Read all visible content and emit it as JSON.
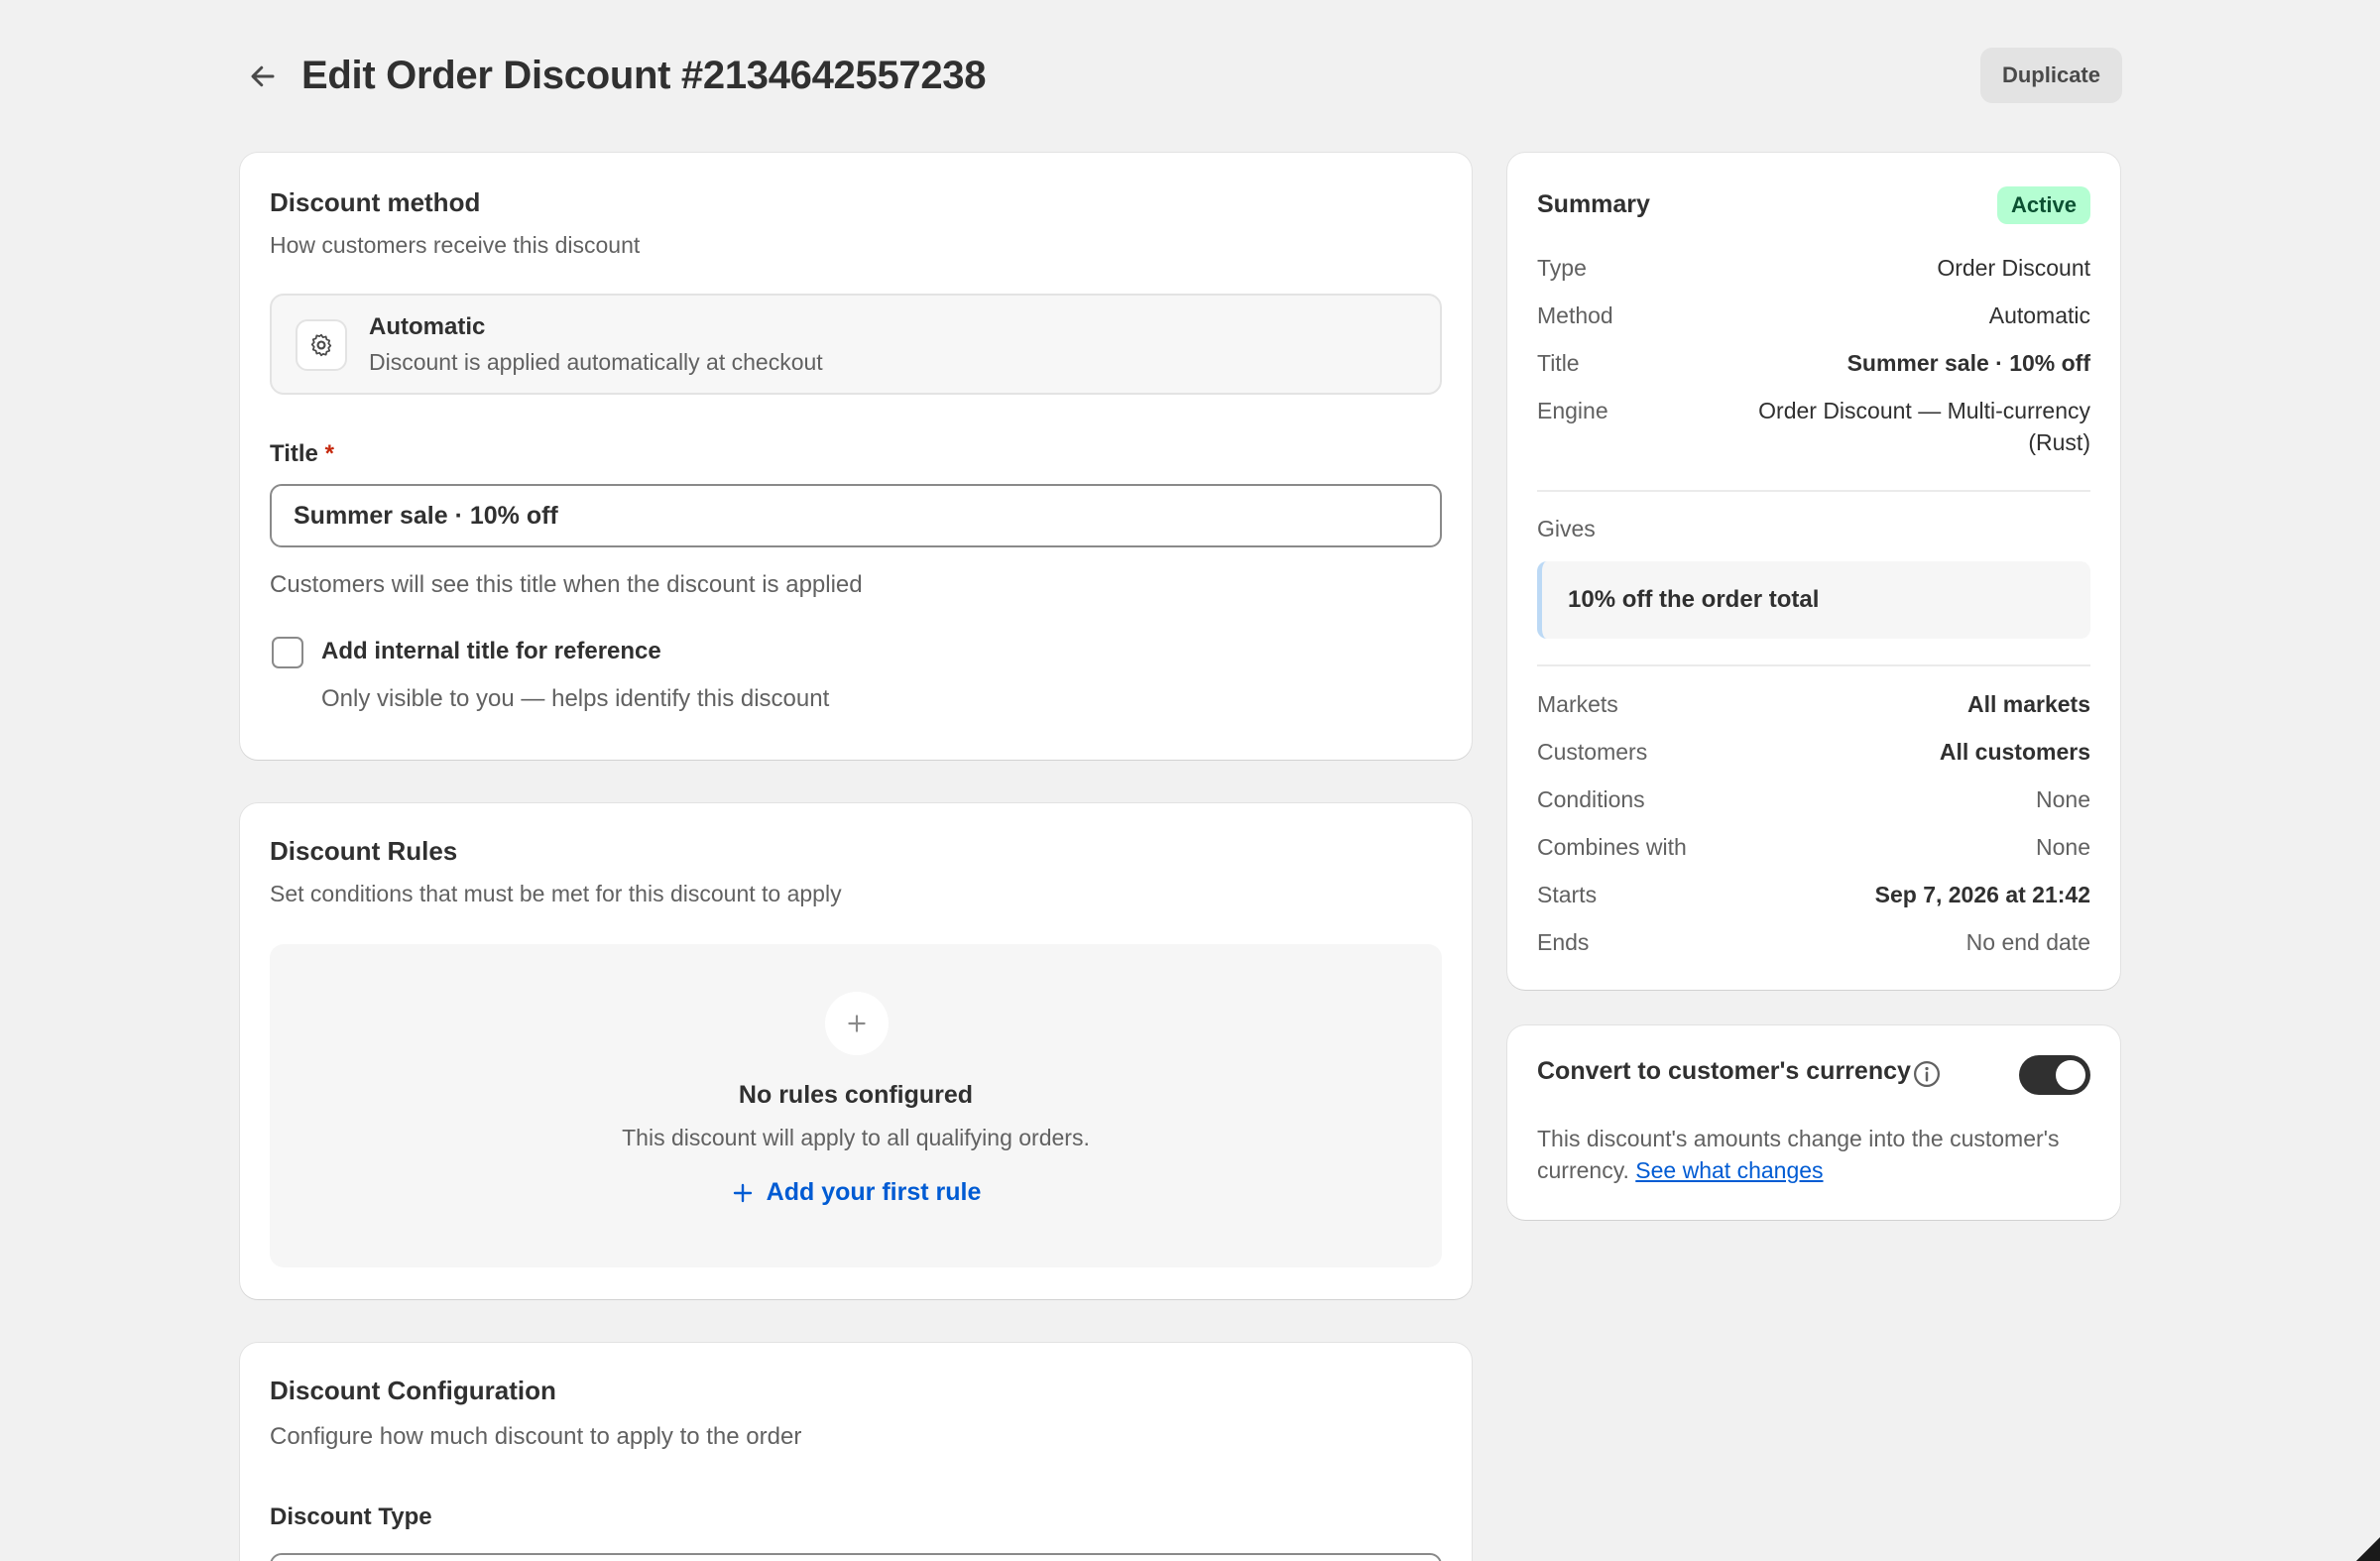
{
  "header": {
    "title": "Edit Order Discount #2134642557238",
    "duplicate_label": "Duplicate"
  },
  "method_card": {
    "title": "Discount method",
    "subtitle": "How customers receive this discount",
    "option_name": "Automatic",
    "option_desc": "Discount is applied automatically at checkout",
    "title_label": "Title",
    "required_mark": "*",
    "title_value": "Summer sale · 10% off",
    "title_help": "Customers will see this title when the discount is applied",
    "internal_checkbox_label": "Add internal title for reference",
    "internal_checkbox_help": "Only visible to you — helps identify this discount"
  },
  "rules_card": {
    "title": "Discount Rules",
    "subtitle": "Set conditions that must be met for this discount to apply",
    "empty_title": "No rules configured",
    "empty_desc": "This discount will apply to all qualifying orders.",
    "add_rule_label": "Add your first rule"
  },
  "config_card": {
    "title": "Discount Configuration",
    "subtitle": "Configure how much discount to apply to the order",
    "type_label": "Discount Type"
  },
  "summary": {
    "title": "Summary",
    "status": "Active",
    "rows_top": [
      {
        "key": "Type",
        "value": "Order Discount"
      },
      {
        "key": "Method",
        "value": "Automatic"
      },
      {
        "key": "Title",
        "value": "Summer sale · 10% off"
      },
      {
        "key": "Engine",
        "value": "Order Discount — Multi-currency",
        "value2": "(Rust)"
      }
    ],
    "gives_label": "Gives",
    "gives_value": "10% off the order total",
    "rows_bottom": [
      {
        "key": "Markets",
        "value": "All markets"
      },
      {
        "key": "Customers",
        "value": "All customers"
      },
      {
        "key": "Conditions",
        "value": "None"
      },
      {
        "key": "Combines with",
        "value": "None"
      },
      {
        "key": "Starts",
        "value": "Sep 7, 2026 at 21:42"
      },
      {
        "key": "Ends",
        "value": "No end date"
      }
    ]
  },
  "currency_card": {
    "title": "Convert to customer's currency",
    "toggle_on": true,
    "desc": "This discount's amounts change into the customer's currency.",
    "link": "See what changes"
  },
  "colors": {
    "background": "#f1f1f1",
    "link": "#005bd3",
    "badge_bg": "#b4fed2",
    "badge_text": "#0c5132",
    "required": "#c5280c",
    "toggle_on": "#303030"
  }
}
